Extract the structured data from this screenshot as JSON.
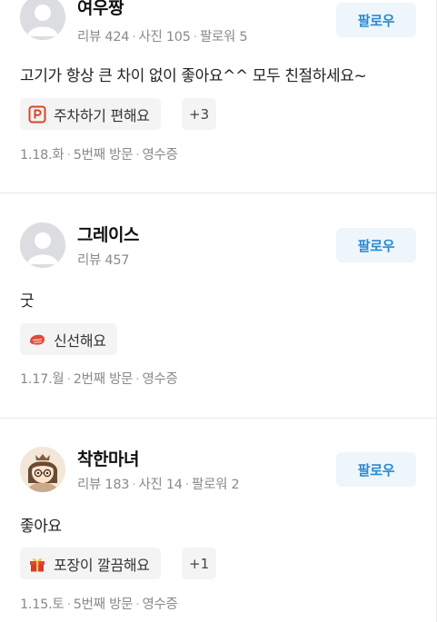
{
  "reviews": [
    {
      "nickname": "여우짱",
      "stats": [
        "리뷰 424",
        "사진 105",
        "팔로워 5"
      ],
      "follow_label": "팔로우",
      "text": "고기가 항상 큰 차이 없이 좋아요^^ 모두 친절하세요~",
      "tag": {
        "icon": "parking-icon",
        "label": "주차하기 편해요"
      },
      "more": "+3",
      "visit": [
        "1.18.화",
        "5번째 방문",
        "영수증"
      ]
    },
    {
      "nickname": "그레이스",
      "stats": [
        "리뷰 457"
      ],
      "follow_label": "팔로우",
      "text": "굿",
      "tag": {
        "icon": "meat-icon",
        "label": "신선해요"
      },
      "visit": [
        "1.17.월",
        "2번째 방문",
        "영수증"
      ]
    },
    {
      "nickname": "착한마녀",
      "stats": [
        "리뷰 183",
        "사진 14",
        "팔로워 2"
      ],
      "follow_label": "팔로우",
      "text": "좋아요",
      "tag": {
        "icon": "gift-icon",
        "label": "포장이 깔끔해요"
      },
      "more": "+1",
      "visit": [
        "1.15.토",
        "5번째 방문",
        "영수증"
      ]
    }
  ],
  "colors": {
    "follow_bg": "#eef6fc",
    "follow_text": "#2b8ad0",
    "meta": "#8a8a8a",
    "tag_bg": "#f4f4f4"
  }
}
